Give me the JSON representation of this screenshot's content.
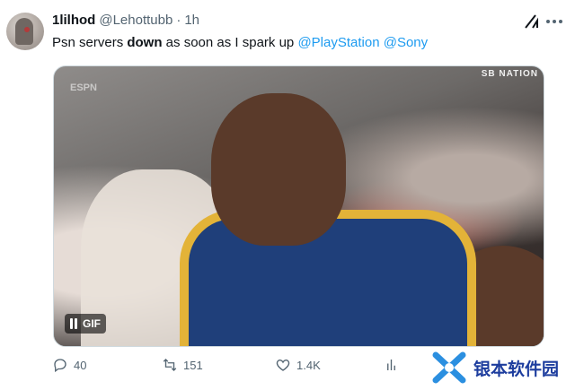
{
  "tweet": {
    "display_name": "1lilhod",
    "handle": "@Lehottubb",
    "separator": "·",
    "time": "1h",
    "text_parts": {
      "p1": "Psn servers ",
      "p2": "down",
      "p3": " as soon as I spark up ",
      "mention1": "@PlayStation",
      "space": " ",
      "mention2": "@Sony"
    }
  },
  "media": {
    "overlay_espn": "ESPN",
    "overlay_brand": "SB NATION",
    "gif_label": "GIF"
  },
  "actions": {
    "replies": "40",
    "reposts": "151",
    "likes": "1.4K"
  },
  "watermark": {
    "text": "银本软件园"
  },
  "colors": {
    "link": "#1d9bf0",
    "muted": "#536471",
    "text": "#0f1419"
  },
  "icons": {
    "grok": "grok-icon",
    "more": "more-icon",
    "reply": "reply-icon",
    "repost": "repost-icon",
    "like": "like-icon",
    "views": "views-icon",
    "pause": "pause-icon"
  }
}
